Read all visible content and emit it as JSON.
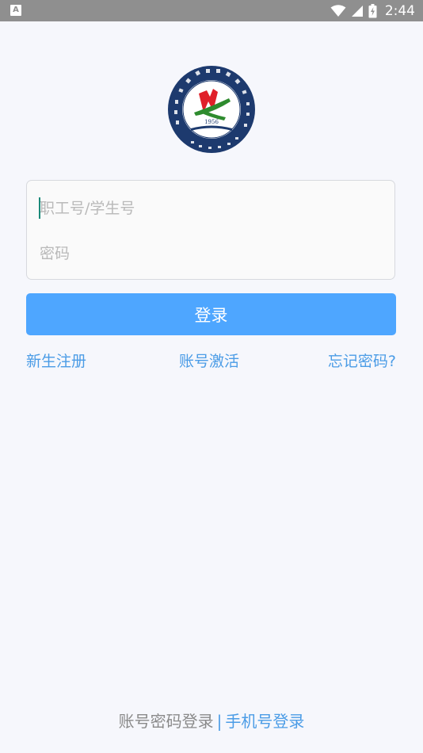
{
  "status_bar": {
    "left_icon": "A",
    "time": "2:44",
    "icons": [
      "wifi-icon",
      "signal-icon",
      "battery-icon"
    ]
  },
  "logo": {
    "year": "1956",
    "icon": "university-logo"
  },
  "form": {
    "id_placeholder": "职工号/学生号",
    "id_value": "",
    "password_placeholder": "密码",
    "password_value": ""
  },
  "login_button": {
    "label": "登录"
  },
  "links": {
    "register": "新生注册",
    "activate": "账号激活",
    "forgot": "忘记密码?"
  },
  "login_modes": {
    "password": "账号密码登录",
    "separator": "|",
    "phone": "手机号登录"
  },
  "colors": {
    "primary": "#4ea6ff",
    "link": "#4b9ce6",
    "background": "#f6f7fc",
    "status_bar": "#8f8f8f"
  }
}
